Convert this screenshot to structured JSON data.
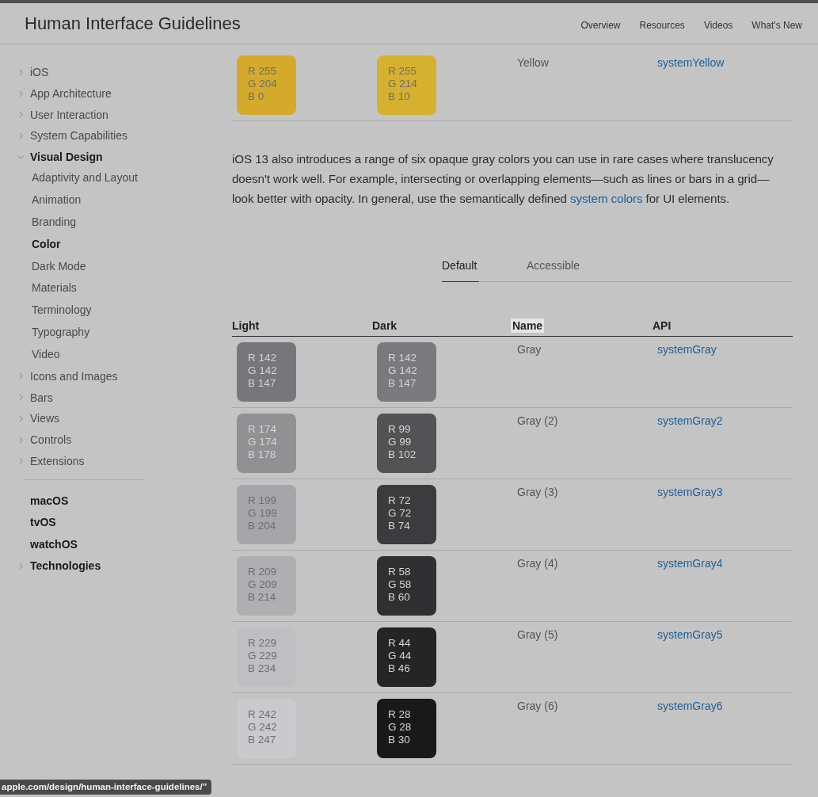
{
  "header": {
    "title": "Human Interface Guidelines",
    "nav": [
      {
        "label": "Overview"
      },
      {
        "label": "Resources"
      },
      {
        "label": "Videos"
      },
      {
        "label": "What's New"
      }
    ]
  },
  "sidebar": {
    "sections": [
      {
        "items": [
          {
            "label": "iOS",
            "kind": "topic",
            "expanded": false,
            "selected": false
          },
          {
            "label": "App Architecture",
            "kind": "topic",
            "expanded": false,
            "selected": false
          },
          {
            "label": "User Interaction",
            "kind": "topic",
            "expanded": false,
            "selected": false
          },
          {
            "label": "System Capabilities",
            "kind": "topic",
            "expanded": false,
            "selected": false
          },
          {
            "label": "Visual Design",
            "kind": "topic",
            "expanded": true,
            "children": [
              {
                "label": "Adaptivity and Layout",
                "selected": false
              },
              {
                "label": "Animation",
                "selected": false
              },
              {
                "label": "Branding",
                "selected": false
              },
              {
                "label": "Color",
                "selected": true
              },
              {
                "label": "Dark Mode",
                "selected": false
              },
              {
                "label": "Materials",
                "selected": false
              },
              {
                "label": "Terminology",
                "selected": false
              },
              {
                "label": "Typography",
                "selected": false
              },
              {
                "label": "Video",
                "selected": false
              }
            ]
          },
          {
            "label": "Icons and Images",
            "kind": "topic",
            "expanded": false,
            "selected": false
          },
          {
            "label": "Bars",
            "kind": "topic",
            "expanded": false,
            "selected": false
          },
          {
            "label": "Views",
            "kind": "topic",
            "expanded": false,
            "selected": false
          },
          {
            "label": "Controls",
            "kind": "topic",
            "expanded": false,
            "selected": false
          },
          {
            "label": "Extensions",
            "kind": "topic",
            "expanded": false,
            "selected": false
          }
        ]
      },
      {
        "items": [
          {
            "label": "macOS",
            "kind": "platform"
          },
          {
            "label": "tvOS",
            "kind": "platform"
          },
          {
            "label": "watchOS",
            "kind": "platform"
          },
          {
            "label": "Technologies",
            "kind": "platform",
            "expanded": false
          }
        ]
      }
    ]
  },
  "upper_table": {
    "rows": [
      {
        "light": {
          "lines": [
            "R 255",
            "G 204",
            "B 0"
          ],
          "color": "#d3aa2c"
        },
        "dark": {
          "lines": [
            "R 255",
            "G 214",
            "B 10"
          ],
          "color": "#d6b12f"
        },
        "name": "Yellow",
        "api": "systemYellow"
      }
    ]
  },
  "paragraph": {
    "text": "iOS 13 also introduces a range of six opaque gray colors you can use in rare cases where translucency doesn't work well. For example, intersecting or overlapping elements—such as lines or bars in a grid—look better with opacity. In general, use the semantically defined",
    "link": "system colors",
    "after": " for UI elements."
  },
  "tabs": [
    {
      "label": "Default",
      "selected": true
    },
    {
      "label": "Accessible",
      "selected": false
    }
  ],
  "table": {
    "columns": [
      {
        "label": "Light",
        "highlighted": false
      },
      {
        "label": "Dark",
        "highlighted": false
      },
      {
        "label": "Name",
        "highlighted": true
      },
      {
        "label": "API",
        "highlighted": false
      }
    ],
    "rows": [
      {
        "light": {
          "lines": [
            "R 142",
            "G 142",
            "B 147"
          ],
          "color": "#77777b"
        },
        "dark": {
          "lines": [
            "R 142",
            "G 142",
            "B 147"
          ],
          "color": "#7a797e"
        },
        "name": "Gray",
        "api": "systemGray"
      },
      {
        "light": {
          "lines": [
            "R 174",
            "G 174",
            "B 178"
          ],
          "color": "#919194"
        },
        "dark": {
          "lines": [
            "R 99",
            "G 99",
            "B 102"
          ],
          "color": "#535355"
        },
        "name": "Gray (2)",
        "api": "systemGray2"
      },
      {
        "light": {
          "lines": [
            "R 199",
            "G 199",
            "B 204"
          ],
          "color": "#a6a6aa"
        },
        "dark": {
          "lines": [
            "R 72",
            "G 72",
            "B 74"
          ],
          "color": "#3c3c3e"
        },
        "name": "Gray (3)",
        "api": "systemGray3"
      },
      {
        "light": {
          "lines": [
            "R 209",
            "G 209",
            "B 214"
          ],
          "color": "#afafb2"
        },
        "dark": {
          "lines": [
            "R 58",
            "G 58",
            "B 60"
          ],
          "color": "#303032"
        },
        "name": "Gray (4)",
        "api": "systemGray4"
      },
      {
        "light": {
          "lines": [
            "R 229",
            "G 229",
            "B 234"
          ],
          "color": "#bfbfc3"
        },
        "dark": {
          "lines": [
            "R 44",
            "G 44",
            "B 46"
          ],
          "color": "#252526"
        },
        "name": "Gray (5)",
        "api": "systemGray5"
      },
      {
        "light": {
          "lines": [
            "R 242",
            "G 242",
            "B 247"
          ],
          "color": "#cacace"
        },
        "dark": {
          "lines": [
            "R 28",
            "G 28",
            "B 30"
          ],
          "color": "#19191a"
        },
        "name": "Gray (6)",
        "api": "systemGray6"
      }
    ]
  },
  "status_bar": {
    "url": "apple.com/design/human-interface-guidelines/”"
  }
}
